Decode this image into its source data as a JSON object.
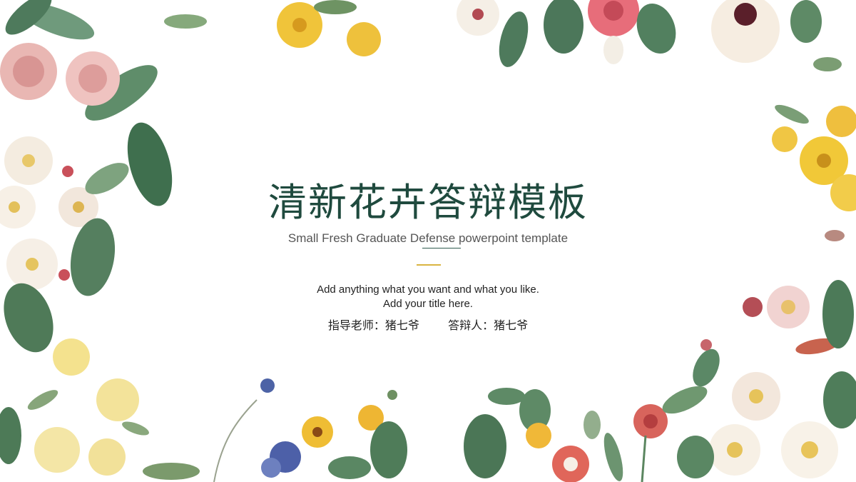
{
  "slide": {
    "title": "清新花卉答辩模板",
    "subtitle": "Small Fresh Graduate Defense powerpoint template",
    "description_line1": "Add anything what you want and what you like.",
    "description_line2": "Add your title here.",
    "advisor": "指导老师：猪七爷",
    "defender": "答辩人：猪七爷"
  },
  "colors": {
    "title": "#1f4a3e",
    "accent_divider": "#d9b441",
    "background": "#ffffff"
  },
  "decorations": [
    "floral-border-illustration"
  ]
}
